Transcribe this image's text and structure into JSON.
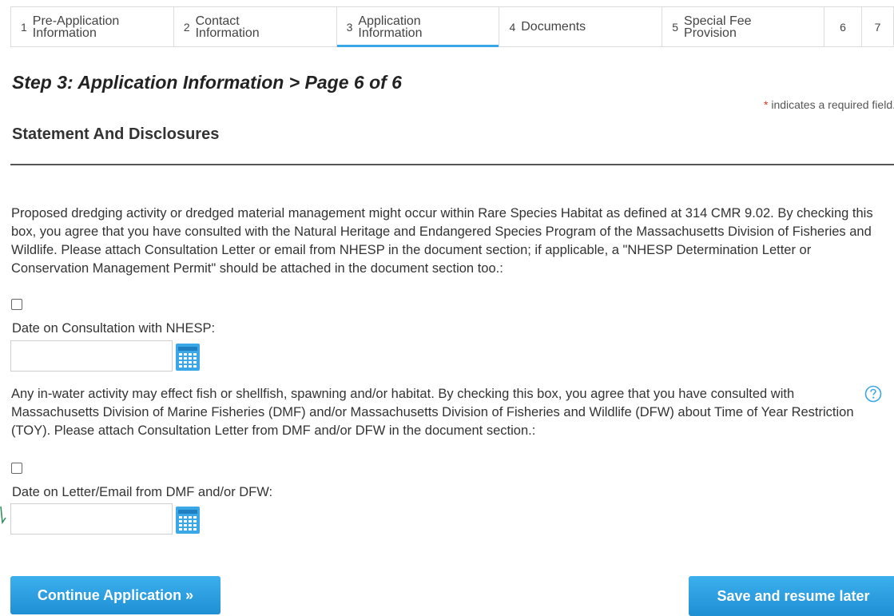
{
  "steps": [
    {
      "num": "1",
      "label": "Pre-Application\nInformation"
    },
    {
      "num": "2",
      "label": "Contact\nInformation"
    },
    {
      "num": "3",
      "label": "Application\nInformation",
      "active": true
    },
    {
      "num": "4",
      "label": "Documents"
    },
    {
      "num": "5",
      "label": "Special Fee\nProvision"
    },
    {
      "num": "6",
      "label": ""
    },
    {
      "num": "7",
      "label": ""
    }
  ],
  "page": {
    "step_title": "Step 3: Application Information > Page 6 of 6",
    "required_star": "*",
    "required_note": " indicates a required field.",
    "section_title": "Statement And Disclosures"
  },
  "form": {
    "q1_text": "Proposed dredging activity or dredged material management might occur within Rare Species Habitat as defined at 314 CMR 9.02. By checking this box, you agree that you have consulted with the Natural Heritage and Endangered Species Program of the Massachusetts Division of Fisheries and Wildlife. Please attach Consultation Letter or email from NHESP in the document section; if applicable, a \"NHESP Determination Letter or Conservation Management Permit\" should be attached in the document section too.:",
    "q1_checked": false,
    "date1_label": "Date on Consultation with NHESP:",
    "date1_value": "",
    "q2_text": "Any in-water activity may effect fish or shellfish, spawning and/or habitat. By checking this box, you agree that you have consulted with Massachusetts Division of Marine Fisheries (DMF) and/or Massachusetts Division of Fisheries and Wildlife (DFW) about Time of Year Restriction (TOY). Please attach Consultation Letter from DMF and/or DFW in the document section.:",
    "q2_checked": false,
    "date2_label": "Date on Letter/Email from DMF and/or DFW:",
    "date2_value": ""
  },
  "buttons": {
    "continue": "Continue Application »",
    "save": "Save and resume later"
  },
  "icons": {
    "calendar": "calendar-icon",
    "help": "question-circle-icon"
  },
  "colors": {
    "accent": "#3aa7e6",
    "required": "#d9342b",
    "button_top": "#3cb0ee",
    "button_bottom": "#1f8fd4"
  }
}
